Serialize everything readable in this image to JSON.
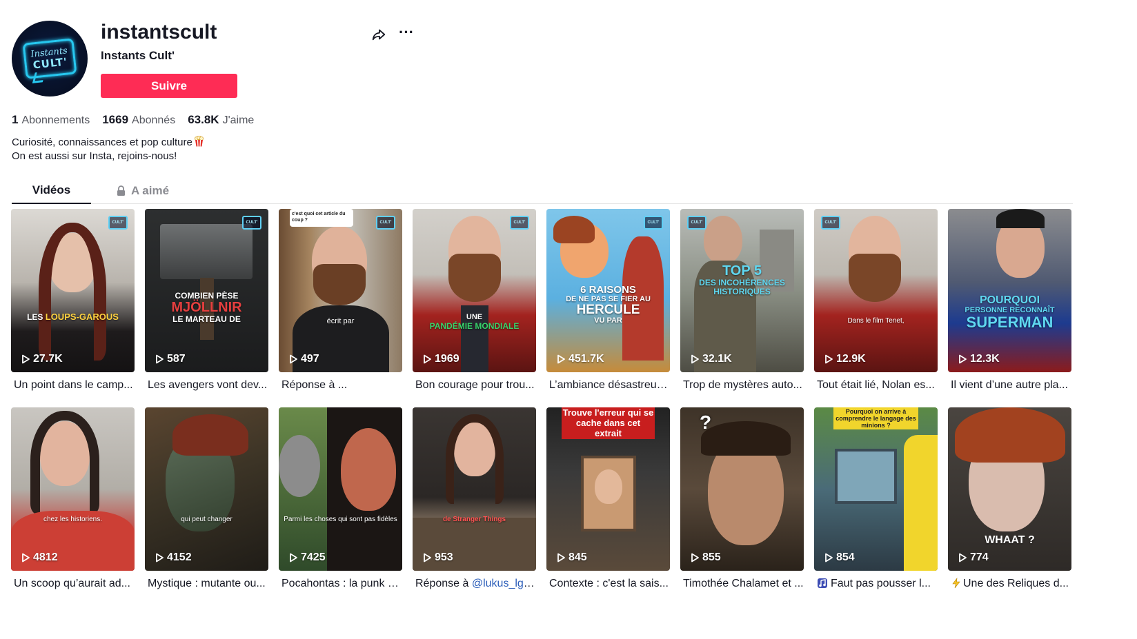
{
  "profile": {
    "username": "instantscult",
    "nickname": "Instants Cult'",
    "avatar_text_line1": "Instants",
    "avatar_text_line2": "CULT'",
    "follow_label": "Suivre"
  },
  "stats": {
    "following_count": "1",
    "following_label": "Abonnements",
    "followers_count": "1669",
    "followers_label": "Abonnés",
    "likes_count": "63.8K",
    "likes_label": "J'aime"
  },
  "bio": {
    "line1": "Curiosité, connaissances et pop culture",
    "line2": "On est aussi sur Insta, rejoins-nous!"
  },
  "tabs": {
    "videos": "Vidéos",
    "liked": "A aimé"
  },
  "icons": {
    "share": "share-icon",
    "more": "more-icon",
    "lock": "lock-icon",
    "play": "play-icon",
    "popcorn": "popcorn-icon"
  },
  "colors": {
    "accent": "#fe2c55",
    "mention": "#2b5db9",
    "text": "#161823",
    "muted": "#55575f"
  },
  "videos": [
    {
      "views": "27.7K",
      "caption": "Un point dans le camp...",
      "overlay1": "LES",
      "overlay2": "LOUPS-GAROUS"
    },
    {
      "views": "587",
      "caption": "Les avengers vont dev...",
      "overlay1": "COMBIEN PÈSE",
      "overlay2": "MJÖLLNIR",
      "overlay3": "LE MARTEAU DE"
    },
    {
      "views": "497",
      "caption": "Réponse à ...",
      "overlay1": "c'est quoi cet article du coup ?",
      "overlay2": "écrit par"
    },
    {
      "views": "1969",
      "caption": "Bon courage pour trou...",
      "overlay1": "UNE",
      "overlay2": "PANDÉMIE MONDIALE"
    },
    {
      "views": "451.7K",
      "caption": "L’ambiance désastreus...",
      "overlay1": "6 RAISONS",
      "overlay2": "DE NE PAS SE FIER AU",
      "overlay3": "HERCULE",
      "overlay4": "VU PAR"
    },
    {
      "views": "32.1K",
      "caption": "Trop de mystères auto...",
      "overlay1": "TOP 5",
      "overlay2": "DES INCOHÉRENCES HISTORIQUES"
    },
    {
      "views": "12.9K",
      "caption": "Tout était lié, Nolan es...",
      "overlay1": "Dans le film Tenet,"
    },
    {
      "views": "12.3K",
      "caption": "Il vient d’une autre pla...",
      "overlay1": "POURQUOI",
      "overlay2": "PERSONNE RECONNAÎT",
      "overlay3": "SUPERMAN"
    },
    {
      "views": "4812",
      "caption": "Un scoop qu’aurait ad...",
      "overlay1": "chez les historiens."
    },
    {
      "views": "4152",
      "caption": "Mystique : mutante ou...",
      "overlay1": "qui peut changer"
    },
    {
      "views": "7425",
      "caption": "Pocahontas : la punk d...",
      "overlay1": "Parmi les choses qui sont pas fidèles"
    },
    {
      "views": "953",
      "caption_prefix": "Réponse à ",
      "caption_mention": "@lukus_lgl",
      "caption_suffix": " ...",
      "overlay1": "de Stranger Things"
    },
    {
      "views": "845",
      "caption": "Contexte : c'est la sais...",
      "overlay1": "Trouve l'erreur qui se cache dans cet extrait"
    },
    {
      "views": "855",
      "caption": "Timothée Chalamet et ...",
      "overlay1": "?"
    },
    {
      "views": "854",
      "caption": "Faut pas pousser l...",
      "overlay1": "Pourquoi on arrive à comprendre le langage des minions ?"
    },
    {
      "views": "774",
      "caption": "Une des Reliques d...",
      "overlay1": "WHAAT ?"
    }
  ]
}
